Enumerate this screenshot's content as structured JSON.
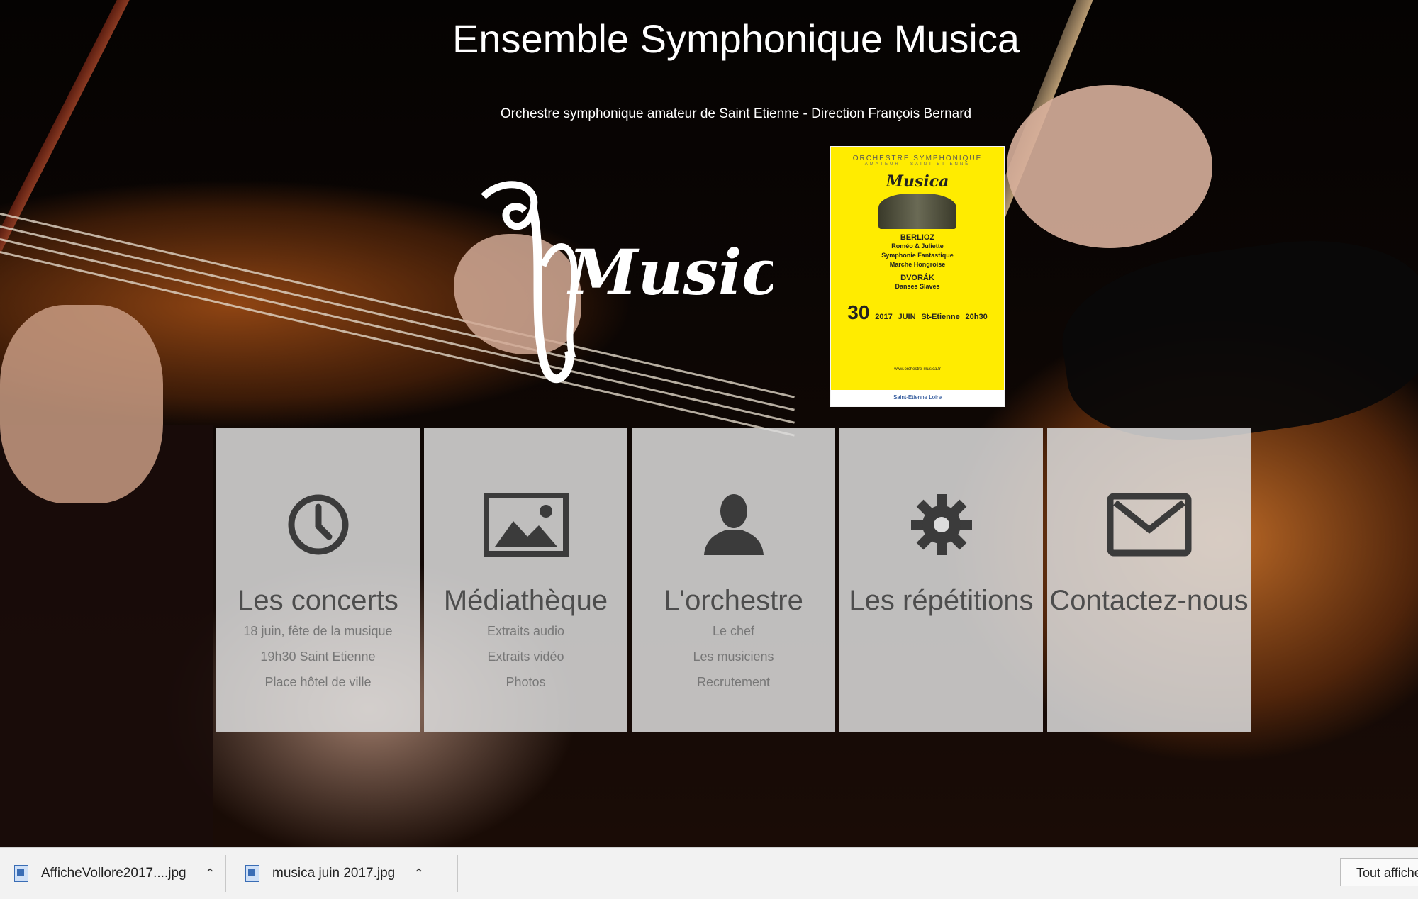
{
  "header": {
    "title": "Ensemble Symphonique Musica",
    "subtitle": "Orchestre symphonique amateur de Saint Etienne - Direction François Bernard"
  },
  "logo": {
    "text": "Musica"
  },
  "poster": {
    "heading": "ORCHESTRE SYMPHONIQUE",
    "subheading": "AMATEUR · SAINT ETIENNE",
    "logo_text": "Musica",
    "composer1": "BERLIOZ",
    "work1": "Roméo & Juliette",
    "work2": "Symphonie Fantastique",
    "work3": "Marche Hongroise",
    "composer2": "DVORÁK",
    "work4": "Danses Slaves",
    "day": "30",
    "year": "2017",
    "month": "JUIN",
    "city": "St-Etienne",
    "time": "20h30",
    "url": "www.orchestre-musica.fr",
    "footer": "Saint-Etienne  Loire"
  },
  "tiles": [
    {
      "icon": "clock-icon",
      "title": "Les concerts",
      "lines": [
        "18 juin, fête de la musique",
        "19h30 Saint Etienne",
        "Place hôtel de ville"
      ]
    },
    {
      "icon": "image-icon",
      "title": "Médiathèque",
      "lines": [
        "Extraits audio",
        "Extraits vidéo",
        "Photos"
      ]
    },
    {
      "icon": "user-icon",
      "title": "L'orchestre",
      "lines": [
        "Le chef",
        "Les musiciens",
        "Recrutement"
      ]
    },
    {
      "icon": "gear-icon",
      "title": "Les répétitions",
      "lines": []
    },
    {
      "icon": "envelope-icon",
      "title": "Contactez-nous",
      "lines": []
    }
  ],
  "downloads": {
    "items": [
      {
        "name": "AfficheVollore2017....jpg"
      },
      {
        "name": "musica  juin 2017.jpg"
      }
    ],
    "show_all_label": "Tout afficher"
  },
  "colors": {
    "tile_bg": "#dcdcdc",
    "tile_icon": "#3b3b3b",
    "poster_bg": "#ffec00",
    "download_bar_bg": "#f2f2f2"
  }
}
